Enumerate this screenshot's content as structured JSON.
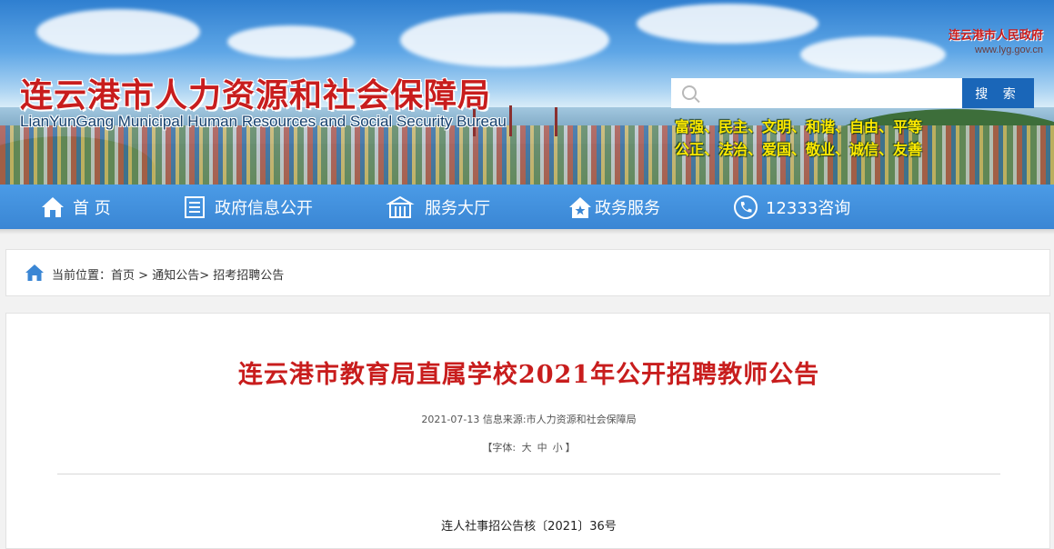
{
  "header": {
    "site_title": "连云港市人力资源和社会保障局",
    "site_subtitle": "LianYunGang Municipal Human Resources and Social Security Bureau",
    "gov_link_name": "连云港市人民政府",
    "gov_link_url": "www.lyg.gov.cn",
    "search": {
      "placeholder": "",
      "button_label": "搜 索"
    },
    "values_line1": "富强、民主、文明、和谐、自由、平等",
    "values_line2": "公正、法治、爱国、敬业、诚信、友善"
  },
  "nav": {
    "items": [
      {
        "label": "首 页",
        "icon": "home-icon"
      },
      {
        "label": "政府信息公开",
        "icon": "document-icon"
      },
      {
        "label": "服务大厅",
        "icon": "building-icon"
      },
      {
        "label": "政务服务",
        "icon": "house-star-icon"
      },
      {
        "label": "12333咨询",
        "icon": "phone-icon"
      }
    ]
  },
  "breadcrumb": {
    "prefix": "当前位置：",
    "items": [
      "首页",
      "通知公告",
      "招考招聘公告"
    ],
    "separators": [
      " > ",
      "> "
    ]
  },
  "article": {
    "title": "连云港市教育局直属学校2021年公开招聘教师公告",
    "date": "2021-07-13",
    "source_label": "信息来源:",
    "source": "市人力资源和社会保障局",
    "font_label": "【字体:",
    "font_sizes": [
      "大",
      "中",
      "小"
    ],
    "font_close": "】",
    "doc_number": "连人社事招公告核〔2021〕36号"
  },
  "colors": {
    "title_red": "#c81d1d",
    "nav_blue": "#3a86d4",
    "search_button_blue": "#1a66b8",
    "values_yellow": "#ffea00"
  }
}
